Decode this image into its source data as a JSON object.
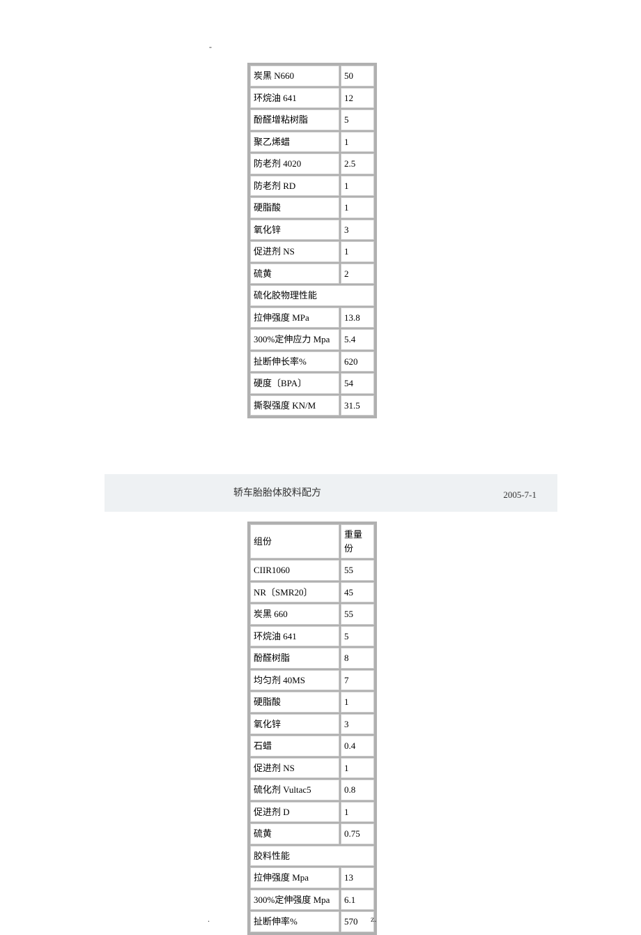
{
  "top_dash": "-",
  "table1": {
    "rows": [
      {
        "label": "炭黑 N660",
        "value": "50"
      },
      {
        "label": "环烷油 641",
        "value": "12"
      },
      {
        "label": "酚醛增粘树脂",
        "value": "5"
      },
      {
        "label": "聚乙烯蜡",
        "value": "1"
      },
      {
        "label": "防老剂 4020",
        "value": "2.5"
      },
      {
        "label": "防老剂 RD",
        "value": "1"
      },
      {
        "label": "硬脂酸",
        "value": "1"
      },
      {
        "label": "氧化锌",
        "value": "3"
      },
      {
        "label": "促进剂 NS",
        "value": "1"
      },
      {
        "label": "硫黄",
        "value": "2"
      }
    ],
    "section_header": "硫化胶物理性能",
    "props": [
      {
        "label": "拉伸强度 MPa",
        "value": "13.8"
      },
      {
        "label": "300%定伸应力 Mpa",
        "value": "5.4"
      },
      {
        "label": "扯断伸长率%",
        "value": "620"
      },
      {
        "label": "硬度〔BPA〕",
        "value": "54"
      },
      {
        "label": "撕裂强度 KN/M",
        "value": "31.5"
      }
    ]
  },
  "title_bar": {
    "title": "轿车胎胎体胶料配方",
    "date": "2005-7-1"
  },
  "table2": {
    "header": {
      "c1": "组份",
      "c2": "重量份"
    },
    "rows": [
      {
        "label": "CIIR1060",
        "value": "55"
      },
      {
        "label": "NR〔SMR20〕",
        "value": "45"
      },
      {
        "label": "炭黑 660",
        "value": "55"
      },
      {
        "label": "环烷油 641",
        "value": "5"
      },
      {
        "label": "酚醛树脂",
        "value": "8"
      },
      {
        "label": "均匀剂 40MS",
        "value": "7"
      },
      {
        "label": "硬脂酸",
        "value": "1"
      },
      {
        "label": "氧化锌",
        "value": "3"
      },
      {
        "label": "石蜡",
        "value": "0.4"
      },
      {
        "label": "促进剂 NS",
        "value": "1"
      },
      {
        "label": "硫化剂 Vultac5",
        "value": "0.8"
      },
      {
        "label": "促进剂 D",
        "value": "1"
      },
      {
        "label": "硫黄",
        "value": "0.75"
      }
    ],
    "section_header": "胶料性能",
    "props": [
      {
        "label": "拉伸强度 Mpa",
        "value": "13"
      },
      {
        "label": "300%定伸强度 Mpa",
        "value": "6.1"
      },
      {
        "label": "扯断伸率%",
        "value": "570"
      }
    ]
  },
  "footer": {
    "dot": ".",
    "z": "z."
  }
}
